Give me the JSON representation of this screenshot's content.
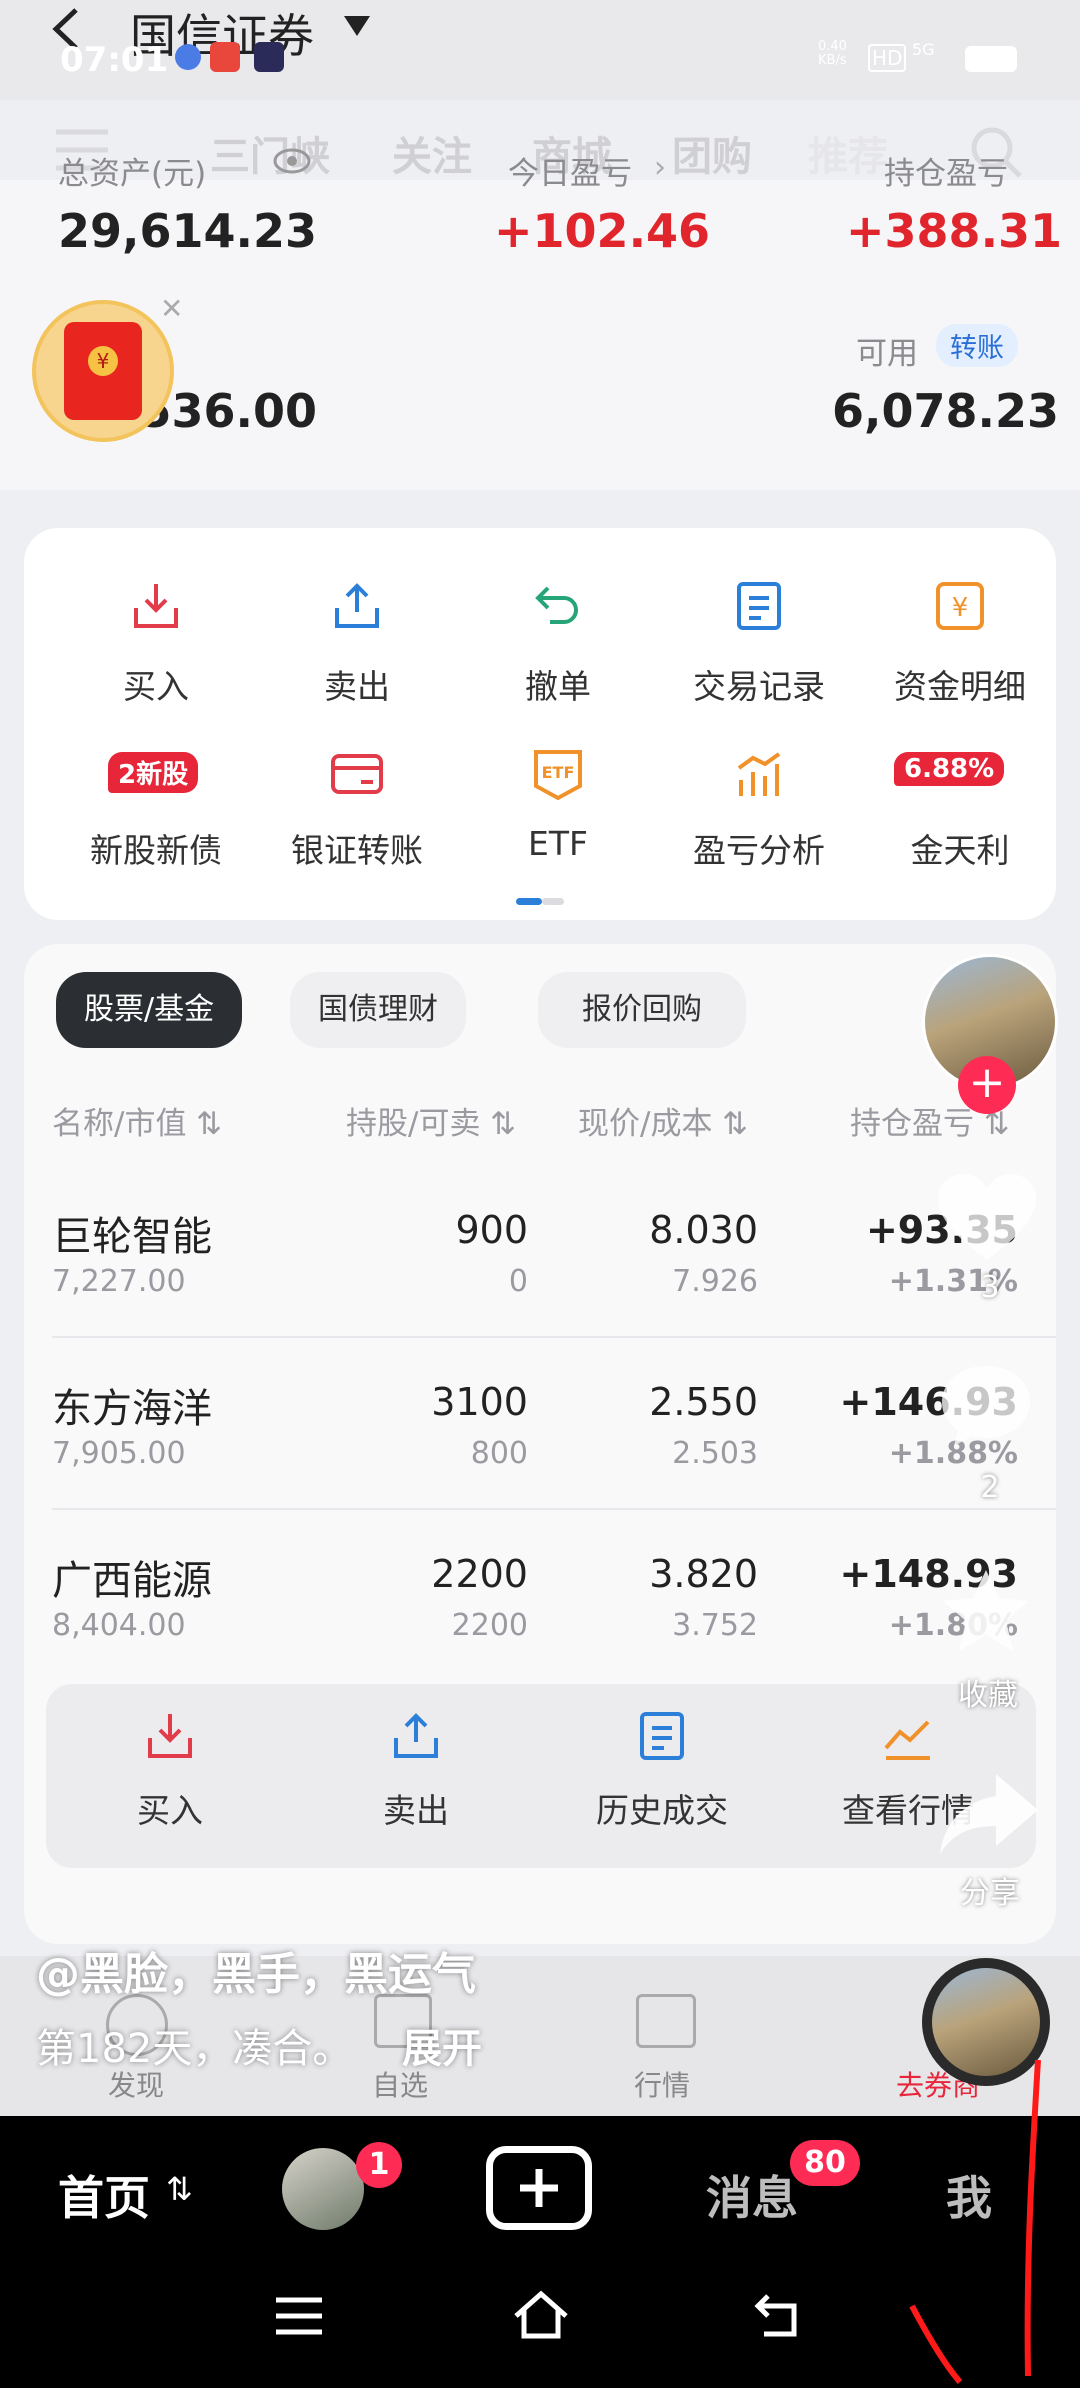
{
  "status": {
    "time": "07:01",
    "net_speed": "0.40\nKB/s",
    "hd": "HD",
    "signal": "5G"
  },
  "app": {
    "title": "国信证券",
    "tabs": [
      "三门峡",
      "关注",
      "商城",
      "团购",
      "推荐"
    ]
  },
  "account": {
    "total_assets_label": "总资产(元)",
    "total_assets": "29,614.23",
    "today_pl_label": "今日盈亏",
    "today_pl": "+102.46",
    "position_pl_label": "持仓盈亏",
    "position_pl": "+388.31",
    "market_value_partial": "23,536.00",
    "available_label": "可用",
    "transfer_label": "转账",
    "available": "6,078.23"
  },
  "grid": [
    {
      "label": "买入",
      "icon": "buy-icon"
    },
    {
      "label": "卖出",
      "icon": "sell-icon"
    },
    {
      "label": "撤单",
      "icon": "undo-icon"
    },
    {
      "label": "交易记录",
      "icon": "record-icon"
    },
    {
      "label": "资金明细",
      "icon": "yen-icon"
    },
    {
      "label": "新股新债",
      "badge": "2新股"
    },
    {
      "label": "银证转账",
      "icon": "card-icon"
    },
    {
      "label": "ETF",
      "icon": "etf-icon"
    },
    {
      "label": "盈亏分析",
      "icon": "chart-icon"
    },
    {
      "label": "金天利",
      "badge": "6.88%"
    }
  ],
  "holdings_tabs": [
    "股票/基金",
    "国债理财",
    "报价回购"
  ],
  "table": {
    "headers": [
      "名称/市值",
      "持股/可卖",
      "现价/成本",
      "持仓盈亏"
    ],
    "rows": [
      {
        "name": "巨轮智能",
        "value": "7,227.00",
        "shares": "900",
        "sellable": "0",
        "price": "8.030",
        "cost": "7.926",
        "pl": "+93.35",
        "pl_pct": "+1.31%"
      },
      {
        "name": "东方海洋",
        "value": "7,905.00",
        "shares": "3100",
        "sellable": "800",
        "price": "2.550",
        "cost": "2.503",
        "pl": "+146.93",
        "pl_pct": "+1.88%"
      },
      {
        "name": "广西能源",
        "value": "8,404.00",
        "shares": "2200",
        "sellable": "2200",
        "price": "3.820",
        "cost": "3.752",
        "pl": "+148.93",
        "pl_pct": "+1.80%"
      }
    ]
  },
  "action_bar": [
    "买入",
    "卖出",
    "历史成交",
    "查看行情"
  ],
  "app_nav": [
    "发现",
    "自选",
    "行情",
    "去券商"
  ],
  "overlay": {
    "author": "@黑脸，黑手，黑运气",
    "caption": "第182天，凑合。",
    "expand": "展开",
    "like_count": "3",
    "comment_count": "2",
    "collect_label": "收藏",
    "share_label": "分享"
  },
  "bottom_nav": {
    "home": "首页",
    "friend_badge": "1",
    "messages": "消息",
    "messages_badge": "80",
    "me": "我"
  }
}
